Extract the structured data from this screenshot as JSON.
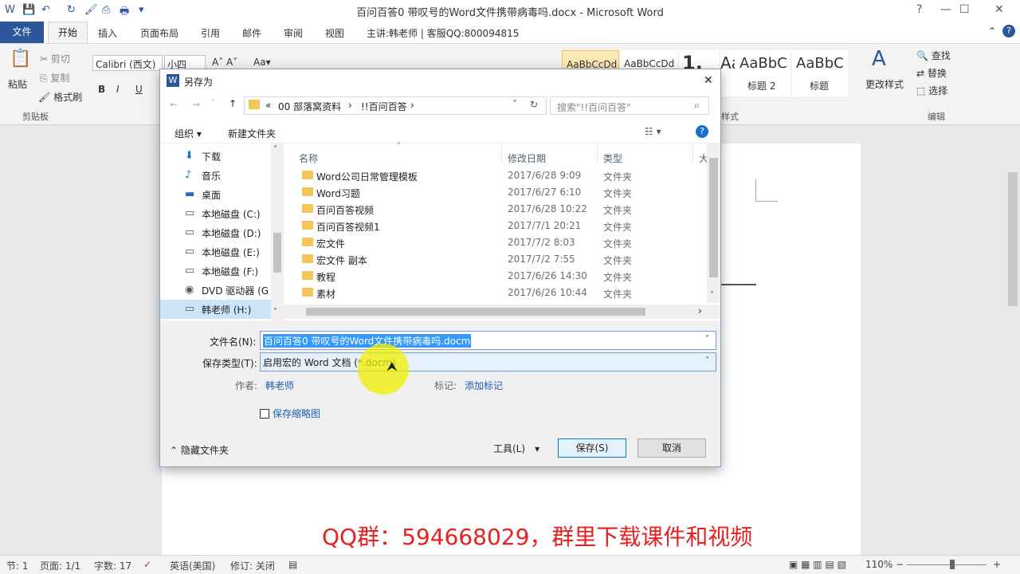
{
  "app": {
    "window_title": "百问百答0 带叹号的Word文件携带病毒吗.docx - Microsoft Word",
    "help": "?",
    "minimize": "—",
    "restore": "☐",
    "close": "✕"
  },
  "ribbon_tabs": {
    "file": "文件",
    "home": "开始",
    "insert": "插入",
    "layout": "页面布局",
    "references": "引用",
    "mailings": "邮件",
    "review": "审阅",
    "view": "视图",
    "presenter": "主讲:韩老师 | 客服QQ:800094815"
  },
  "ribbon": {
    "paste": "粘贴",
    "cut": "剪切",
    "copy": "复制",
    "format_painter": "格式刷",
    "clipboard_group": "剪贴板",
    "font_name": "Calibri (西文)",
    "font_size": "小四",
    "bold": "B",
    "italic": "I",
    "underline": "U",
    "styles": [
      {
        "sample": "AaBbCcDd",
        "name": ""
      },
      {
        "sample": "AaBbCcDd",
        "name": ""
      },
      {
        "sample": "1.",
        "name": ""
      },
      {
        "sample": "Aa",
        "name": ""
      },
      {
        "sample": "AaBbC",
        "name": "标题 2"
      },
      {
        "sample": "AaBbC",
        "name": "标题"
      }
    ],
    "styles_group": "样式",
    "change_styles": "更改样式",
    "find": "查找",
    "replace": "替换",
    "select": "选择",
    "editing_group": "编辑"
  },
  "dialog": {
    "title": "另存为",
    "close": "✕",
    "address_parts": [
      "«",
      "00 部落窝资料",
      "›",
      "!!百问百答",
      "›"
    ],
    "search_placeholder": "搜索\"!!百问百答\"",
    "organize": "组织 ▾",
    "new_folder": "新建文件夹",
    "nav_items": [
      {
        "icon": "download-icon",
        "label": "下载"
      },
      {
        "icon": "music-icon",
        "label": "音乐"
      },
      {
        "icon": "desktop-icon",
        "label": "桌面"
      },
      {
        "icon": "drive-icon",
        "label": "本地磁盘 (C:)"
      },
      {
        "icon": "drive-icon",
        "label": "本地磁盘 (D:)"
      },
      {
        "icon": "drive-icon",
        "label": "本地磁盘 (E:)"
      },
      {
        "icon": "drive-icon",
        "label": "本地磁盘 (F:)"
      },
      {
        "icon": "dvd-icon",
        "label": "DVD 驱动器 (G"
      },
      {
        "icon": "drive-icon",
        "label": "韩老师 (H:)"
      }
    ],
    "columns": {
      "name": "名称",
      "date": "修改日期",
      "type": "类型",
      "size": "大"
    },
    "files": [
      {
        "name": "Word公司日常管理模板",
        "date": "2017/6/28 9:09",
        "type": "文件夹"
      },
      {
        "name": "Word习题",
        "date": "2017/6/27 6:10",
        "type": "文件夹"
      },
      {
        "name": "百问百答视频",
        "date": "2017/6/28 10:22",
        "type": "文件夹"
      },
      {
        "name": "百问百答视频1",
        "date": "2017/7/1 20:21",
        "type": "文件夹"
      },
      {
        "name": "宏文件",
        "date": "2017/7/2 8:03",
        "type": "文件夹"
      },
      {
        "name": "宏文件 副本",
        "date": "2017/7/2 7:55",
        "type": "文件夹"
      },
      {
        "name": "教程",
        "date": "2017/6/26 14:30",
        "type": "文件夹"
      },
      {
        "name": "素材",
        "date": "2017/6/26 10:44",
        "type": "文件夹"
      }
    ],
    "filename_label": "文件名(N):",
    "filename_value": "百问百答0 带叹号的Word文件携带病毒吗.docm",
    "filetype_label": "保存类型(T):",
    "filetype_value": "启用宏的 Word 文档 (*.docm)",
    "author_label": "作者:",
    "author_value": "韩老师",
    "tags_label": "标记:",
    "tags_value": "添加标记",
    "thumbnail_label": "保存缩略图",
    "hide_folders": "隐藏文件夹",
    "tools": "工具(L)",
    "save": "保存(S)",
    "cancel": "取消"
  },
  "status_bar": {
    "section": "节: 1",
    "page": "页面: 1/1",
    "words": "字数: 17",
    "language": "英语(美国)",
    "track_changes": "修订: 关闭",
    "zoom": "110%"
  },
  "overlay": {
    "watermark": "QQ群：594668029，群里下载课件和视频"
  }
}
